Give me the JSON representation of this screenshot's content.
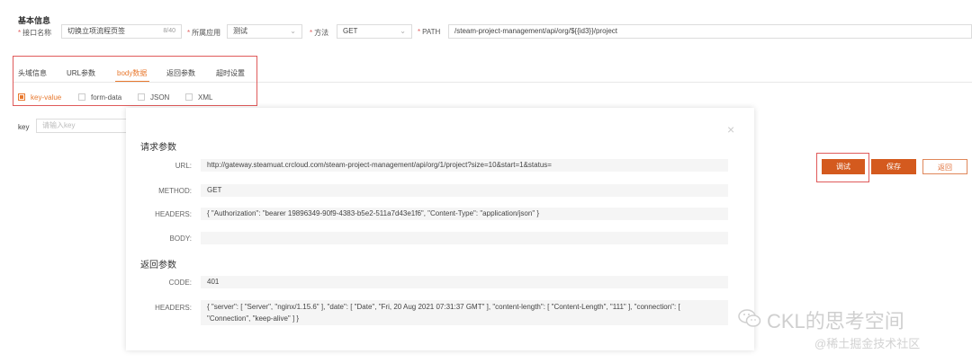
{
  "basic_info": {
    "title": "基本信息"
  },
  "form": {
    "api_name_label": "接口名称",
    "api_name_value": "切换立项流程页签",
    "api_name_counter": "8/40",
    "app_label": "所属应用",
    "app_value": "测试",
    "method_label": "方法",
    "method_value": "GET",
    "path_label": "PATH",
    "path_value": "/steam-project-management/api/org/${{id3}}/project",
    "required_mark": "*"
  },
  "tabs": [
    "头域信息",
    "URL参数",
    "body数据",
    "返回参数",
    "超时设置"
  ],
  "active_tab": "body数据",
  "body_types": [
    {
      "label": "key-value",
      "checked": true
    },
    {
      "label": "form-data",
      "checked": false
    },
    {
      "label": "JSON",
      "checked": false
    },
    {
      "label": "XML",
      "checked": false
    }
  ],
  "kv": {
    "key_label": "key",
    "key_placeholder": "请输入key"
  },
  "modal": {
    "request_title": "请求参数",
    "url_label": "URL:",
    "url_value": "http://gateway.steamuat.crcloud.com/steam-project-management/api/org/1/project?size=10&start=1&status=",
    "method_label": "METHOD:",
    "method_value": "GET",
    "headers_label": "HEADERS:",
    "headers_value": "{ \"Authorization\": \"bearer 19896349-90f9-4383-b5e2-511a7d43e1f6\", \"Content-Type\": \"application/json\" }",
    "body_label": "BODY:",
    "body_value": "",
    "response_title": "返回参数",
    "code_label": "CODE:",
    "code_value": "401",
    "resp_headers_label": "HEADERS:",
    "resp_headers_value": "{ \"server\": [ \"Server\", \"nginx/1.15.6\" ], \"date\": [ \"Date\", \"Fri, 20 Aug 2021 07:31:37 GMT\" ], \"content-length\": [ \"Content-Length\", \"111\" ], \"connection\": [ \"Connection\", \"keep-alive\" ] }",
    "close_icon": "×"
  },
  "buttons": {
    "test": "调试",
    "save": "保存",
    "back": "返回"
  },
  "watermark": {
    "line1": "CKL的思考空间",
    "line2": "@稀土掘金技术社区"
  },
  "colors": {
    "accent": "#d45a1e",
    "highlight_box": "#e05a5a",
    "tab_active": "#e8792f"
  }
}
